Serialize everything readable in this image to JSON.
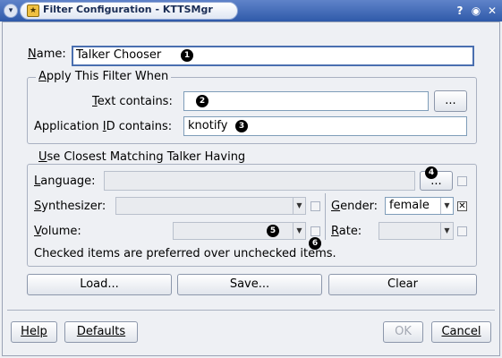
{
  "window": {
    "title": "Filter Configuration - KTTSMgr",
    "menu_glyph": "▾",
    "help_glyph": "?",
    "maximize_glyph": "◉",
    "close_glyph": "✕"
  },
  "name_field": {
    "label": "Name:",
    "value": "Talker Chooser",
    "marker": "1"
  },
  "apply_group": {
    "title": "Apply This Filter When",
    "text_contains": {
      "label": "Text contains:",
      "value": "",
      "marker": "2",
      "browse_label": "..."
    },
    "app_id_contains": {
      "label": "Application ID contains:",
      "value": "knotify",
      "marker": "3"
    }
  },
  "talker_group": {
    "title": "Use Closest Matching Talker Having",
    "language": {
      "label": "Language:",
      "value": "",
      "browse_label": "...",
      "marker": "4",
      "checked": false
    },
    "synthesizer": {
      "label": "Synthesizer:",
      "value": "",
      "checked": false
    },
    "gender": {
      "label": "Gender:",
      "value": "female",
      "checked": true
    },
    "volume": {
      "label": "Volume:",
      "value": "",
      "marker": "5",
      "checked": false,
      "checkbox_marker": "6"
    },
    "rate": {
      "label": "Rate:",
      "value": "",
      "checked": false
    },
    "note": "Checked items are preferred over unchecked items."
  },
  "actions": {
    "load": "Load...",
    "save": "Save...",
    "clear": "Clear"
  },
  "footer": {
    "help": "Help",
    "defaults": "Defaults",
    "ok": "OK",
    "cancel": "Cancel"
  }
}
